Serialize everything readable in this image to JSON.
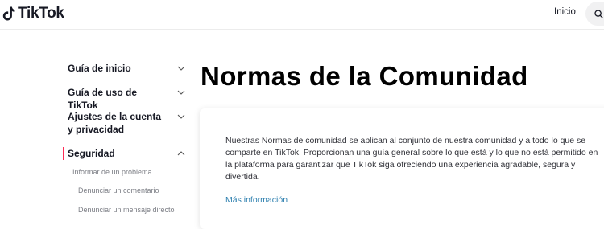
{
  "header": {
    "brand": "TikTok",
    "nav_home": "Inicio",
    "search_icon": "search-icon"
  },
  "sidebar": {
    "items": [
      {
        "label": "Guía de inicio",
        "state": "collapsed",
        "icon": "chevron-down-icon"
      },
      {
        "label": "Guía de uso de TikTok",
        "state": "collapsed",
        "icon": "chevron-down-icon"
      },
      {
        "label": "Ajustes de la cuenta y privacidad",
        "state": "collapsed",
        "icon": "chevron-down-icon"
      },
      {
        "label": "Seguridad",
        "state": "expanded",
        "active": true,
        "icon": "chevron-up-icon"
      }
    ],
    "sub_items": [
      {
        "label": "Informar de un problema"
      },
      {
        "label": "Denunciar un comentario"
      },
      {
        "label": "Denunciar un mensaje directo"
      }
    ],
    "active_color": "#fe2c55"
  },
  "main": {
    "title": "Normas de la Comunidad",
    "card": {
      "body": "Nuestras Normas de comunidad se aplican al conjunto de nuestra comunidad y a todo lo que se comparte en TikTok. Proporcionan una guía general sobre lo que está y lo que no está permitido en la plataforma para garantizar que TikTok siga ofreciendo una experiencia agradable, segura y divertida.",
      "link": "Más información",
      "link_color": "#2b7eae"
    }
  }
}
